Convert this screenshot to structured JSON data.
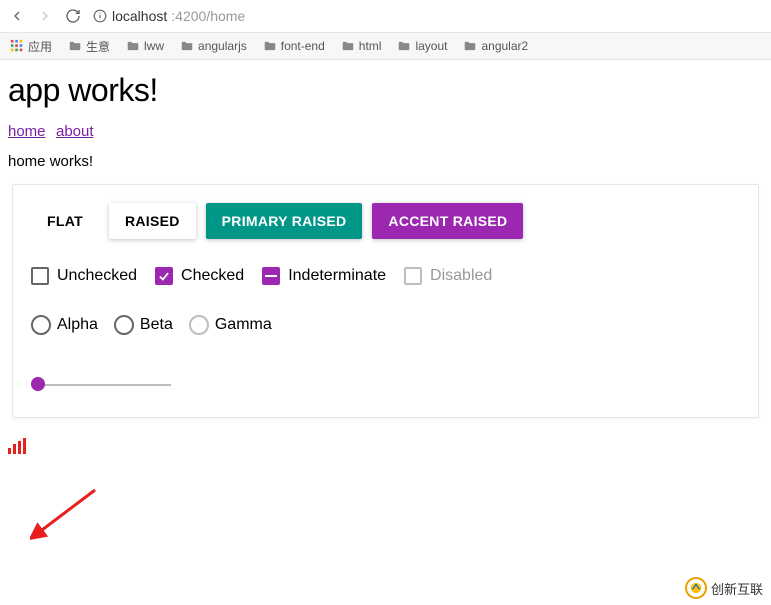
{
  "browser": {
    "url_host": "localhost",
    "url_path": ":4200/home"
  },
  "bookmarks": {
    "apps": "应用",
    "items": [
      "生意",
      "lww",
      "angularjs",
      "font-end",
      "html",
      "layout",
      "angular2"
    ]
  },
  "page": {
    "title": "app works!",
    "nav": {
      "home": "home",
      "about": "about"
    },
    "subtitle": "home works!"
  },
  "buttons": {
    "flat": "FLAT",
    "raised": "RAISED",
    "primary": "PRIMARY RAISED",
    "accent": "ACCENT RAISED"
  },
  "checkboxes": {
    "unchecked": "Unchecked",
    "checked": "Checked",
    "indeterminate": "Indeterminate",
    "disabled": "Disabled"
  },
  "radios": {
    "alpha": "Alpha",
    "beta": "Beta",
    "gamma": "Gamma"
  },
  "slider": {
    "value": 0,
    "min": 0,
    "max": 100
  },
  "watermark": "创新互联"
}
